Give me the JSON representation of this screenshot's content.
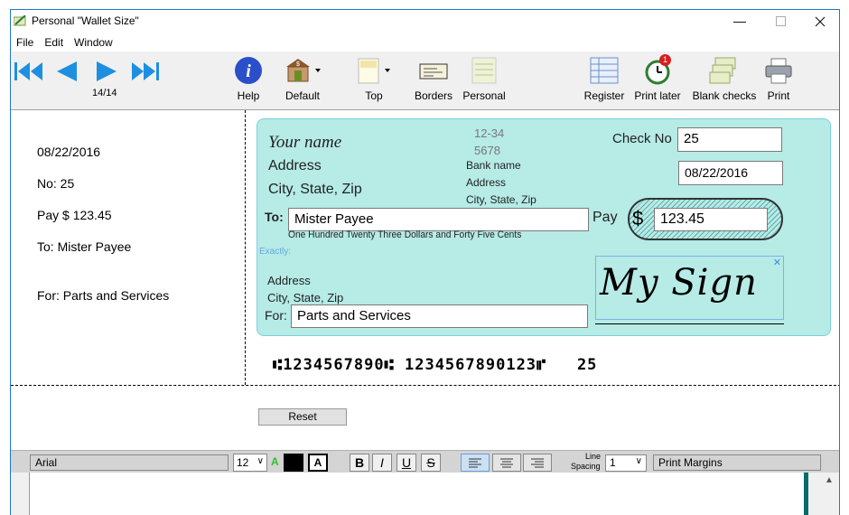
{
  "window": {
    "title": "Personal \"Wallet Size\""
  },
  "menu": [
    "File",
    "Edit",
    "Window"
  ],
  "nav": {
    "page_indicator": "14/14"
  },
  "toolbar": {
    "help": "Help",
    "default": "Default",
    "top": "Top",
    "borders": "Borders",
    "personal": "Personal",
    "register": "Register",
    "print_later": "Print later",
    "print_later_badge": "1",
    "blank_checks": "Blank checks",
    "print": "Print"
  },
  "stub": {
    "date": "08/22/2016",
    "number": "No: 25",
    "pay": "Pay $ 123.45",
    "to": "To: Mister Payee",
    "for": "For: Parts and Services"
  },
  "check": {
    "your_name": "Your name",
    "address": "Address",
    "city_state_zip": "City, State, Zip",
    "fraction_1": "12-34",
    "fraction_2": "5678",
    "bank_name": "Bank name",
    "bank_address": "Address",
    "bank_city": "City, State, Zip",
    "check_no_label": "Check No",
    "check_no_value": "25",
    "date_value": "08/22/2016",
    "to_label": "To:",
    "payee": "Mister Payee",
    "pay_label": "Pay",
    "dollar_sign": "$",
    "amount": "123.45",
    "amount_words": "One Hundred Twenty Three Dollars and Forty Five Cents",
    "exactly": "Exactly:",
    "payee_address": "Address",
    "payee_city": "City, State, Zip",
    "for_label": "For:",
    "memo": "Parts and Services",
    "signature": "My Sign",
    "micr": "⑆1234567890⑆ 1234567890123⑈   25"
  },
  "reset_label": "Reset",
  "format": {
    "font": "Arial",
    "size": "12",
    "color_a": "A",
    "bg_a": "A",
    "bold": "B",
    "italic": "I",
    "underline": "U",
    "strike": "S",
    "line_spacing_label_1": "Line",
    "line_spacing_label_2": "Spacing",
    "line_spacing_value": "1",
    "print_margins": "Print Margins"
  },
  "colors": {
    "check_bg": "#b6ebe6",
    "accent": "#1e78c8"
  }
}
